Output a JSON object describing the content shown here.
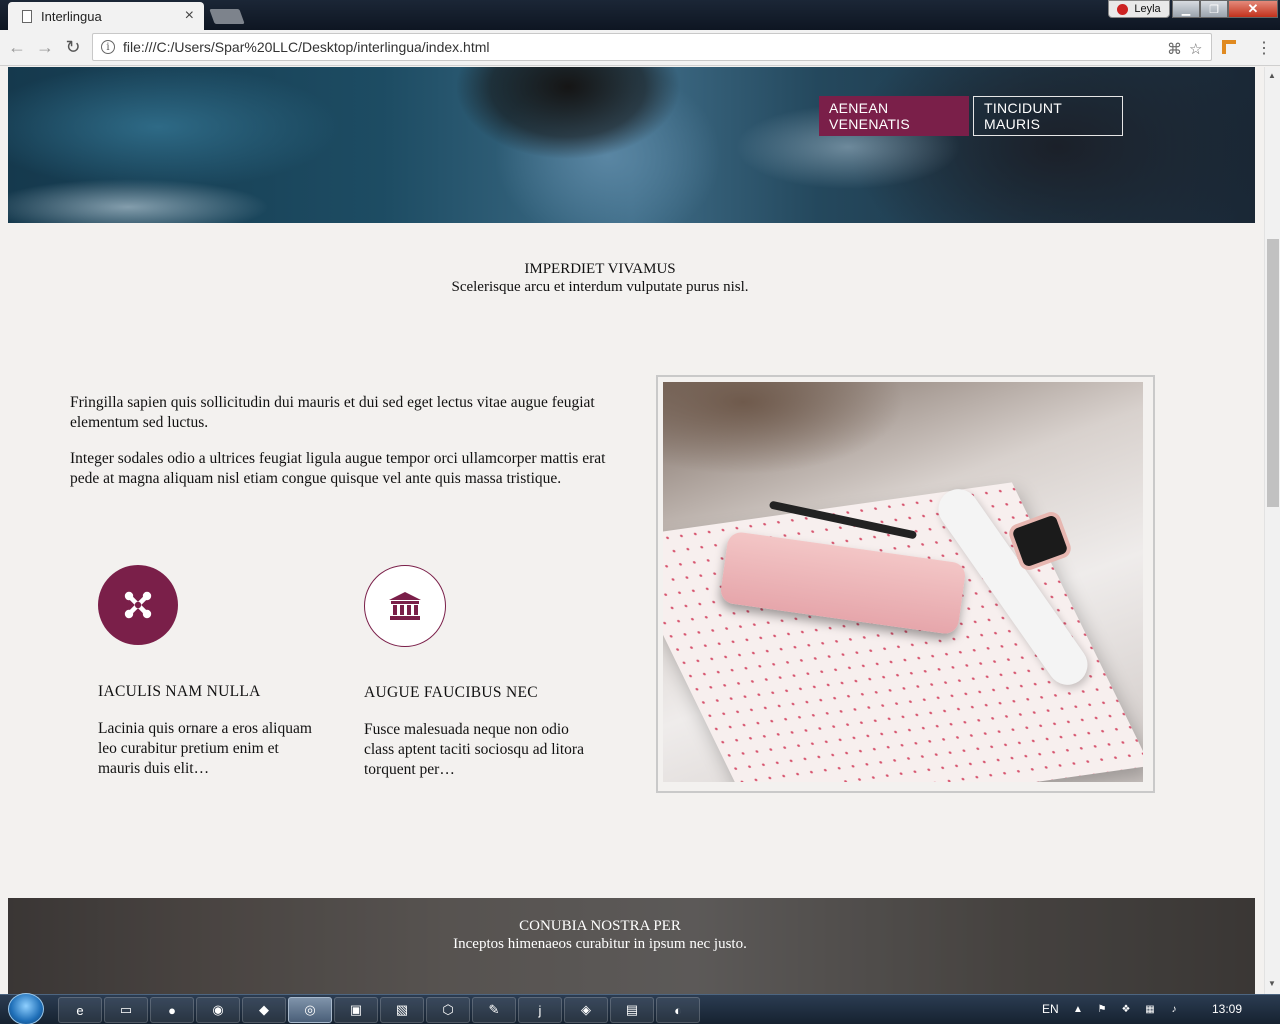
{
  "browser": {
    "tab_title": "Interlingua",
    "tab_close": "×",
    "address": "file:///C:/Users/Spar%20LLC/Desktop/interlingua/index.html",
    "profile_name": "Leyla"
  },
  "hero": {
    "buttons": [
      {
        "label": "AENEAN VENENATIS",
        "style": "primary"
      },
      {
        "label": "TINCIDUNT MAURIS",
        "style": "outline"
      }
    ]
  },
  "intro": {
    "heading": "IMPERDIET VIVAMUS",
    "subheading": "Scelerisque arcu et interdum vulputate purus nisl."
  },
  "content": {
    "paragraphs": [
      "Fringilla sapien quis sollicitudin dui mauris et dui sed eget lectus vitae augue feugiat elementum sed luctus.",
      "Integer sodales odio a ultrices feugiat ligula augue tempor orci ullamcorper mattis erat pede at magna aliquam nisl etiam congue quisque vel ante quis massa tristique."
    ],
    "features": [
      {
        "icon": "joomla-icon",
        "title": "IACULIS NAM NULLA",
        "text": "Lacinia quis ornare a eros aliquam leo curabitur pretium enim et mauris duis elit…"
      },
      {
        "icon": "bank-icon",
        "title": "AUGUE FAUCIBUS NEC",
        "text": "Fusce malesuada neque non odio class aptent taciti sociosqu ad litora torquent per…"
      }
    ]
  },
  "footer_section": {
    "heading": "CONUBIA NOSTRA PER",
    "subheading": "Inceptos himenaeos curabitur in ipsum nec justo."
  },
  "taskbar": {
    "language": "EN",
    "clock": "13:09"
  },
  "colors": {
    "accent": "#7a1f49",
    "page_background": "#f3f1ef"
  }
}
